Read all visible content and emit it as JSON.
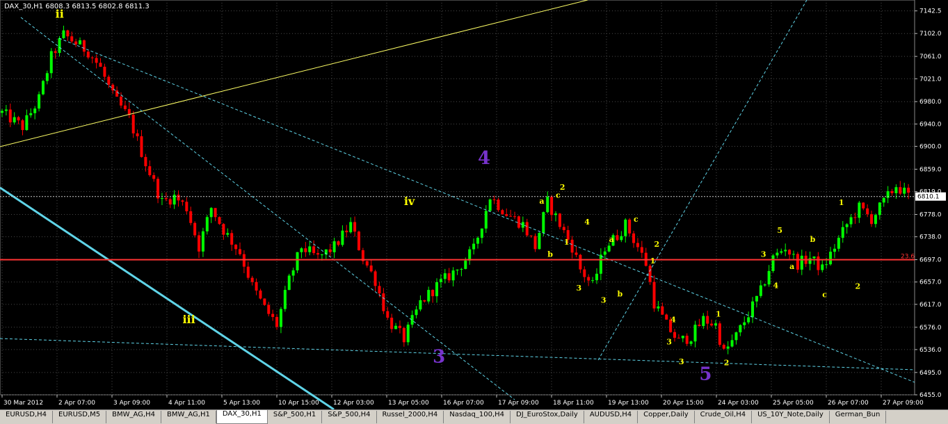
{
  "window": {
    "title": "DAX_30,H1",
    "ohlc": "6808.3 6813.5 6802.8 6811.3"
  },
  "colors": {
    "background": "#000000",
    "bull_candle": "#00ff00",
    "bear_candle": "#ff0000",
    "grid": "#4a4a4a",
    "trendline": "#5fd4e8",
    "yellow_line": "#ffff66",
    "level_line": "#ff3333",
    "wave_label_yellow": "#ffff00",
    "wave_label_purple": "#7733cc"
  },
  "chart_data": {
    "type": "candlestick",
    "symbol": "DAX_30",
    "timeframe": "H1",
    "ylim": [
      6455,
      7162
    ],
    "y_ticks": [
      7142.5,
      7102.0,
      7061.0,
      7021.0,
      6980.0,
      6940.0,
      6900.0,
      6859.0,
      6819.0,
      6778.0,
      6738.0,
      6697.0,
      6657.0,
      6617.0,
      6576.0,
      6536.0,
      6495.0,
      6455.0
    ],
    "x_labels": [
      "30 Mar 2012",
      "2 Apr 07:00",
      "3 Apr 09:00",
      "4 Apr 11:00",
      "5 Apr 13:00",
      "10 Apr 15:00",
      "12 Apr 03:00",
      "13 Apr 05:00",
      "16 Apr 07:00",
      "17 Apr 09:00",
      "18 Apr 11:00",
      "19 Apr 13:00",
      "20 Apr 15:00",
      "24 Apr 03:00",
      "25 Apr 05:00",
      "26 Apr 07:00",
      "27 Apr 09:00"
    ],
    "price_path": [
      [
        0,
        6960
      ],
      [
        5,
        6935
      ],
      [
        9,
        6985
      ],
      [
        12,
        7060
      ],
      [
        15,
        7100
      ],
      [
        21,
        7070
      ],
      [
        24,
        7040
      ],
      [
        27,
        6990
      ],
      [
        31,
        6950
      ],
      [
        35,
        6870
      ],
      [
        39,
        6800
      ],
      [
        42,
        6810
      ],
      [
        45,
        6790
      ],
      [
        48,
        6720
      ],
      [
        51,
        6790
      ],
      [
        54,
        6750
      ],
      [
        58,
        6710
      ],
      [
        61,
        6650
      ],
      [
        64,
        6610
      ],
      [
        67,
        6580
      ],
      [
        70,
        6660
      ],
      [
        73,
        6720
      ],
      [
        77,
        6700
      ],
      [
        81,
        6720
      ],
      [
        85,
        6760
      ],
      [
        88,
        6700
      ],
      [
        91,
        6660
      ],
      [
        94,
        6590
      ],
      [
        98,
        6555
      ],
      [
        102,
        6620
      ],
      [
        106,
        6650
      ],
      [
        111,
        6680
      ],
      [
        115,
        6715
      ],
      [
        119,
        6810
      ],
      [
        123,
        6780
      ],
      [
        127,
        6760
      ],
      [
        130,
        6720
      ],
      [
        133,
        6800
      ],
      [
        136,
        6760
      ],
      [
        139,
        6720
      ],
      [
        141,
        6680
      ],
      [
        144,
        6650
      ],
      [
        147,
        6720
      ],
      [
        150,
        6740
      ],
      [
        152,
        6760
      ],
      [
        155,
        6720
      ],
      [
        157,
        6690
      ],
      [
        159,
        6620
      ],
      [
        162,
        6580
      ],
      [
        165,
        6550
      ],
      [
        168,
        6560
      ],
      [
        171,
        6590
      ],
      [
        174,
        6580
      ],
      [
        176,
        6530
      ],
      [
        179,
        6560
      ],
      [
        182,
        6600
      ],
      [
        185,
        6640
      ],
      [
        188,
        6700
      ],
      [
        191,
        6720
      ],
      [
        194,
        6690
      ],
      [
        197,
        6700
      ],
      [
        200,
        6680
      ],
      [
        203,
        6720
      ],
      [
        206,
        6760
      ],
      [
        209,
        6790
      ],
      [
        212,
        6770
      ],
      [
        215,
        6800
      ],
      [
        218,
        6830
      ],
      [
        221,
        6811
      ]
    ],
    "current_price": 6810.1,
    "level_lines": [
      {
        "value": 6697,
        "label": "23.6"
      }
    ],
    "wave_labels": [
      {
        "text": "ii",
        "x": 13,
        "y": 7130,
        "color": "yellow"
      },
      {
        "text": "iii",
        "x": 44,
        "y": 6583,
        "color": "yellow"
      },
      {
        "text": "iv",
        "x": 98,
        "y": 6795,
        "color": "yellow"
      },
      {
        "text": "4",
        "x": 116,
        "y": 6868,
        "color": "purple"
      },
      {
        "text": "3",
        "x": 105,
        "y": 6513,
        "color": "purple"
      },
      {
        "text": "5",
        "x": 170,
        "y": 6482,
        "color": "purple"
      },
      {
        "text": "2",
        "x": 136,
        "y": 6822,
        "color": "yellow"
      },
      {
        "text": "a",
        "x": 131,
        "y": 6797,
        "color": "yellow"
      },
      {
        "text": "c",
        "x": 135,
        "y": 6808,
        "color": "yellow"
      },
      {
        "text": "4",
        "x": 142,
        "y": 6760,
        "color": "yellow"
      },
      {
        "text": "1",
        "x": 137,
        "y": 6724,
        "color": "yellow"
      },
      {
        "text": "b",
        "x": 133,
        "y": 6702,
        "color": "yellow"
      },
      {
        "text": "3",
        "x": 140,
        "y": 6642,
        "color": "yellow"
      },
      {
        "text": "c",
        "x": 154,
        "y": 6765,
        "color": "yellow"
      },
      {
        "text": "a",
        "x": 148,
        "y": 6729,
        "color": "yellow"
      },
      {
        "text": "2",
        "x": 159,
        "y": 6720,
        "color": "yellow"
      },
      {
        "text": "3",
        "x": 146,
        "y": 6620,
        "color": "yellow"
      },
      {
        "text": "b",
        "x": 150,
        "y": 6631,
        "color": "yellow"
      },
      {
        "text": "1",
        "x": 158,
        "y": 6690,
        "color": "yellow"
      },
      {
        "text": "4",
        "x": 163,
        "y": 6585,
        "color": "yellow"
      },
      {
        "text": "3",
        "x": 162,
        "y": 6545,
        "color": "yellow"
      },
      {
        "text": "3",
        "x": 165,
        "y": 6510,
        "color": "yellow"
      },
      {
        "text": "1",
        "x": 174,
        "y": 6595,
        "color": "yellow"
      },
      {
        "text": "2",
        "x": 176,
        "y": 6508,
        "color": "yellow"
      },
      {
        "text": "5",
        "x": 189,
        "y": 6745,
        "color": "yellow"
      },
      {
        "text": "3",
        "x": 185,
        "y": 6702,
        "color": "yellow"
      },
      {
        "text": "4",
        "x": 188,
        "y": 6646,
        "color": "yellow"
      },
      {
        "text": "a",
        "x": 192,
        "y": 6680,
        "color": "yellow"
      },
      {
        "text": "b",
        "x": 197,
        "y": 6729,
        "color": "yellow"
      },
      {
        "text": "c",
        "x": 200,
        "y": 6630,
        "color": "yellow"
      },
      {
        "text": "1",
        "x": 204,
        "y": 6795,
        "color": "yellow"
      },
      {
        "text": "2",
        "x": 208,
        "y": 6645,
        "color": "yellow"
      }
    ]
  },
  "tabs": [
    "EURUSD,H4",
    "EURUSD,M5",
    "BMW_AG,H4",
    "BMW_AG,H1",
    "DAX_30,H1",
    "S&P_500,H1",
    "S&P_500,H4",
    "Russel_2000,H4",
    "Nasdaq_100,H4",
    "DJ_EuroStox,Daily",
    "AUDUSD,H4",
    "Copper,Daily",
    "Crude_Oil,H4",
    "US_10Y_Note,Daily",
    "German_Bun"
  ],
  "active_tab": 4
}
